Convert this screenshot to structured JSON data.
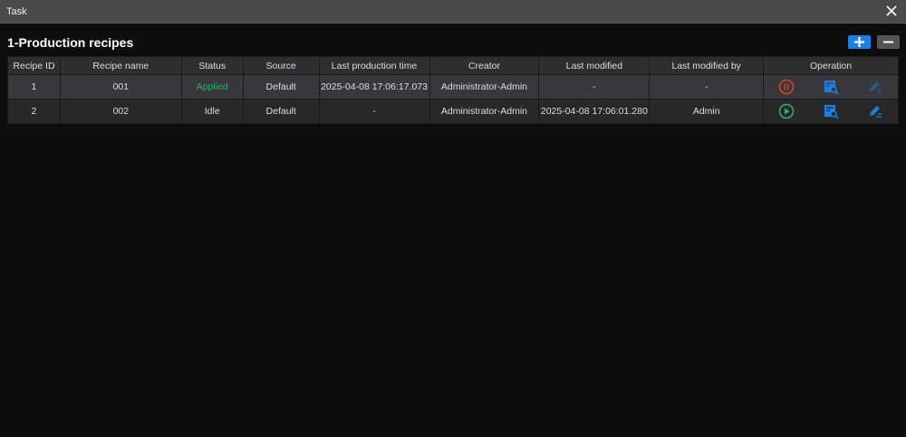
{
  "window": {
    "title": "Task"
  },
  "section": {
    "title": "1-Production recipes"
  },
  "colors": {
    "applied": "#2faa6a",
    "pause": "#d9432b",
    "play": "#2fb36f",
    "accent": "#1e7fe0"
  },
  "table": {
    "columns": [
      "Recipe ID",
      "Recipe name",
      "Status",
      "Source",
      "Last production time",
      "Creator",
      "Last modified",
      "Last modified by",
      "Operation"
    ],
    "rows": [
      {
        "id": "1",
        "name": "001",
        "status": "Applied",
        "source": "Default",
        "last_production": "2025-04-08 17:06:17.073",
        "creator": "Administrator-Admin",
        "last_modified": "-",
        "modified_by": "-",
        "toggle_icon": "pause-icon",
        "edit_enabled": false
      },
      {
        "id": "2",
        "name": "002",
        "status": "Idle",
        "source": "Default",
        "last_production": "-",
        "creator": "Administrator-Admin",
        "last_modified": "2025-04-08 17:06:01.280",
        "modified_by": "Admin",
        "toggle_icon": "play-icon",
        "edit_enabled": true
      }
    ]
  }
}
